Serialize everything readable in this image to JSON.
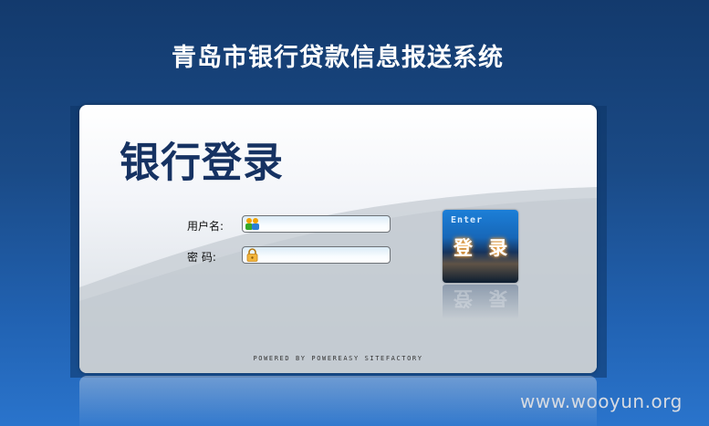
{
  "page": {
    "title": "青岛市银行贷款信息报送系统"
  },
  "login_panel": {
    "heading": "银行登录",
    "username_label": "用户名:",
    "username_value": "",
    "password_label": "密 码:",
    "password_value": "",
    "button_enter_text": "Enter",
    "button_label": "登 录",
    "footer": "POWERED BY POWEREASY SITEFACTORY"
  },
  "watermark": "www.wooyun.org",
  "colors": {
    "background_top": "#133a6d",
    "background_bottom": "#2a74cc",
    "heading": "#163262",
    "button_blue": "#1767b8"
  },
  "icons": {
    "username": "users-icon",
    "password": "lock-icon"
  }
}
